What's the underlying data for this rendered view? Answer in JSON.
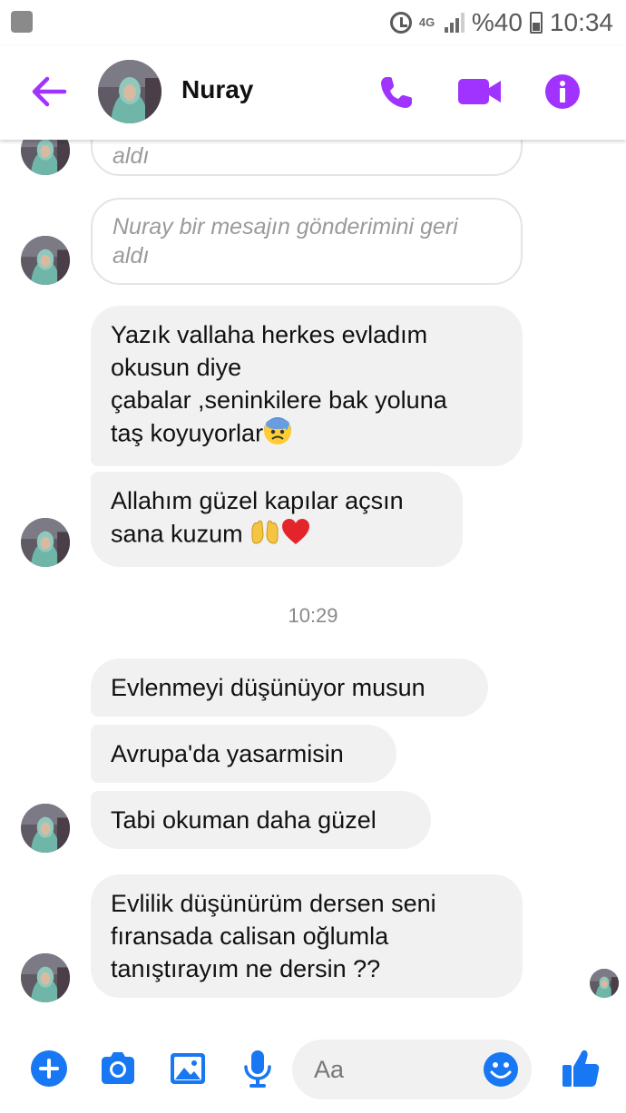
{
  "theme": {
    "accent": "#a033ff",
    "blue": "#1877f2"
  },
  "status_bar": {
    "network": "4G",
    "battery": "%40",
    "time": "10:34"
  },
  "header": {
    "contact_name": "Nuray"
  },
  "messages": [
    {
      "type": "removed",
      "text": "aldı"
    },
    {
      "type": "removed",
      "text": "Nuray bir mesajın gönderimini geri\naldı"
    },
    {
      "type": "text",
      "text": "Yazık vallaha herkes evladım\nokusun diye\nçabalar ,seninkilere bak yoluna\ntaş koyuyorlar"
    },
    {
      "type": "text",
      "text": "Allahım güzel kapılar açsın\nsana kuzum "
    },
    {
      "type": "timestamp",
      "text": "10:29"
    },
    {
      "type": "text",
      "text": "Evlenmeyi düşünüyor musun"
    },
    {
      "type": "text",
      "text": "Avrupa'da yasarmisin"
    },
    {
      "type": "text",
      "text": "Tabi okuman daha güzel"
    },
    {
      "type": "text",
      "text": "Evlilik düşünürüm dersen seni\nfıransada calisan oğlumla\ntanıştırayım ne dersin ??"
    }
  ],
  "composer": {
    "placeholder": "Aa"
  }
}
